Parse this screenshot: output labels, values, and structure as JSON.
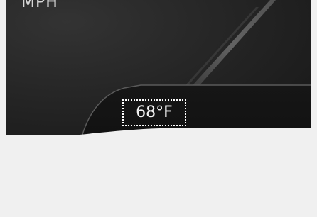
{
  "cluster": {
    "speed_unit": "MPH",
    "outside_temperature": "68°F"
  }
}
